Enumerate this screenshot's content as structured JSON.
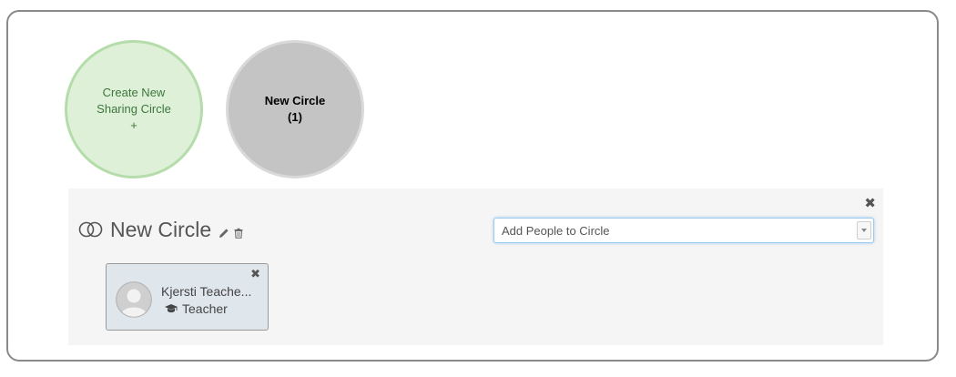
{
  "circles": {
    "create": {
      "line1": "Create New",
      "line2": "Sharing Circle",
      "line3": "+"
    },
    "existing": [
      {
        "name": "New Circle",
        "count": "(1)"
      }
    ]
  },
  "panel": {
    "title": "New Circle",
    "add_people": {
      "placeholder": "Add People to Circle"
    },
    "members": [
      {
        "name": "Kjersti Teache...",
        "role": "Teacher"
      }
    ]
  },
  "colors": {
    "create_circle_bg": "#dff0d8",
    "create_circle_text": "#3c763d",
    "existing_circle_bg": "#c4c4c4",
    "panel_bg": "#f5f5f5",
    "member_card_bg": "#dfe6ec"
  },
  "icons": {
    "circles": "rings-icon",
    "edit": "pencil-icon",
    "delete": "trash-icon",
    "close": "close-icon",
    "role": "graduation-cap-icon",
    "dropdown": "chevron-down-icon"
  }
}
